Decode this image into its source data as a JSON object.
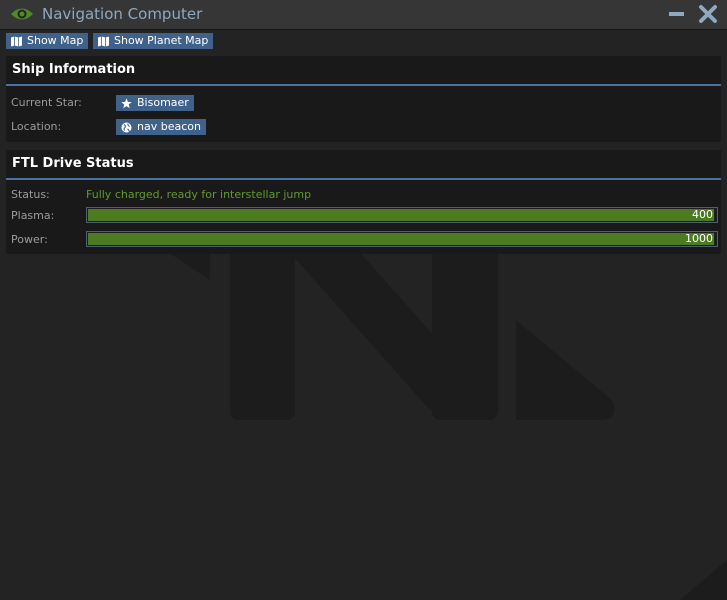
{
  "window": {
    "title": "Navigation Computer",
    "minimize_icon": "minimize-icon",
    "close_icon": "close-icon",
    "title_icon": "eye-icon"
  },
  "toolbar": {
    "show_map_label": "Show Map",
    "show_planet_map_label": "Show Planet Map",
    "map_icon": "map-icon"
  },
  "ship_info": {
    "title": "Ship Information",
    "current_star_label": "Current Star:",
    "current_star_value": "Bisomaer",
    "current_star_icon": "star-icon",
    "location_label": "Location:",
    "location_value": "nav beacon",
    "location_icon": "globe-icon"
  },
  "ftl": {
    "title": "FTL Drive Status",
    "status_label": "Status:",
    "status_value": "Fully charged, ready for interstellar jump",
    "plasma_label": "Plasma:",
    "plasma_value": "400",
    "plasma_fraction": 1.0,
    "power_label": "Power:",
    "power_value": "1000",
    "power_fraction": 1.0
  },
  "colors": {
    "accent": "#40628a",
    "status_good": "#5f9a2c",
    "bar_fill": "#4d7b22",
    "title_text": "#8ea8c0"
  }
}
